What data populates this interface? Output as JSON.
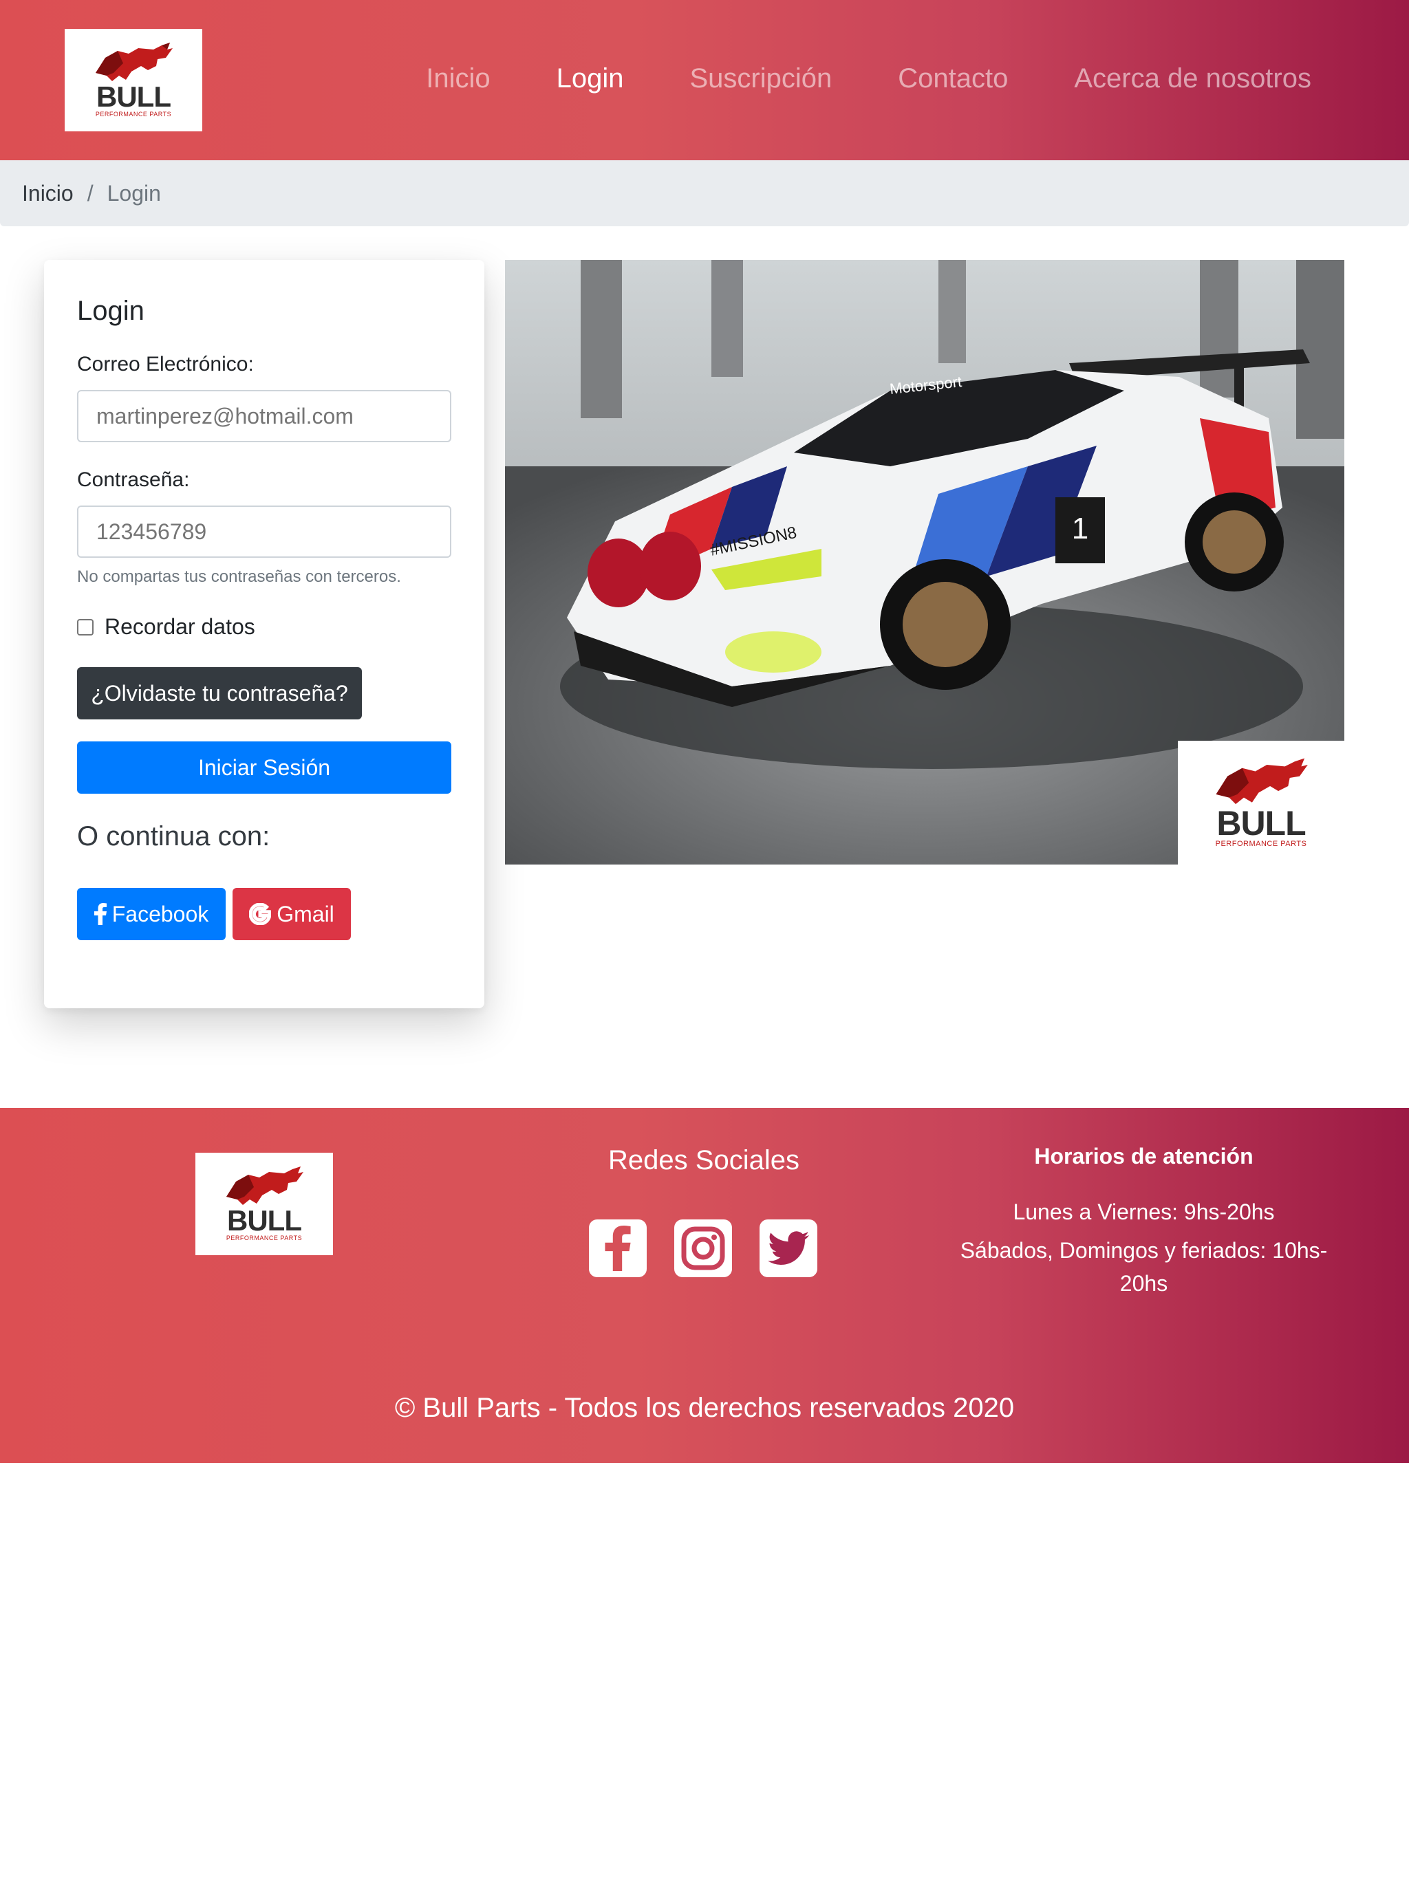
{
  "brand": {
    "logo_word": "BULL",
    "logo_subtitle": "PERFORMANCE PARTS",
    "colors": {
      "bull_red": "#c11c1c",
      "bull_dark": "#7d0e0e",
      "text": "#2f2f2f"
    }
  },
  "nav": {
    "items": [
      {
        "label": "Inicio",
        "active": false
      },
      {
        "label": "Login",
        "active": true
      },
      {
        "label": "Suscripción",
        "active": false
      },
      {
        "label": "Contacto",
        "active": false
      },
      {
        "label": "Acerca de nosotros",
        "active": false
      }
    ]
  },
  "breadcrumb": {
    "home": "Inicio",
    "separator": "/",
    "current": "Login"
  },
  "login": {
    "title": "Login",
    "email_label": "Correo Electrónico:",
    "email_placeholder": "martinperez@hotmail.com",
    "password_label": "Contraseña:",
    "password_placeholder": "123456789",
    "password_help": "No compartas tus contraseñas con terceros.",
    "remember_label": "Recordar datos",
    "forgot_button": "¿Olvidaste tu contraseña?",
    "submit_button": "Iniciar Sesión",
    "alt_title": "O continua con:",
    "facebook_button": "Facebook",
    "gmail_button": "Gmail"
  },
  "hero": {
    "car_livery_text": "#MISSION8",
    "car_brand_text": "Motorsport",
    "race_number": "1"
  },
  "footer": {
    "social_title": "Redes Sociales",
    "social_icons": [
      "facebook-icon",
      "instagram-icon",
      "twitter-icon"
    ],
    "hours_title": "Horarios de atención",
    "hours_weekdays": "Lunes a Viernes: 9hs-20hs",
    "hours_weekend": "Sábados, Domingos y feriados: 10hs-20hs",
    "copyright": "© Bull Parts - Todos los derechos reservados 2020"
  },
  "colors": {
    "gradient_start": "#dc4f53",
    "gradient_end": "#9c1a45",
    "primary": "#007bff",
    "danger": "#dc3545",
    "dark": "#343a40",
    "breadcrumb_bg": "#e9ecef"
  }
}
